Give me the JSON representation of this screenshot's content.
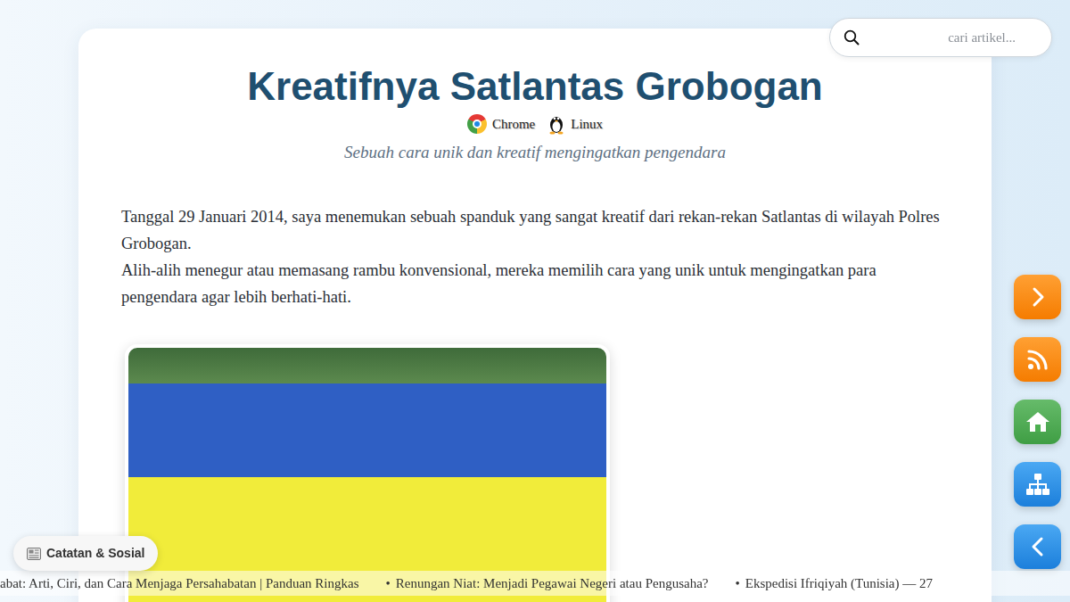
{
  "search": {
    "placeholder": "cari artikel..."
  },
  "article": {
    "title": "Kreatifnya Satlantas Grobogan",
    "platforms": [
      {
        "label": "Chrome",
        "kind": "chrome"
      },
      {
        "label": "Linux",
        "kind": "linux"
      }
    ],
    "subtitle": "Sebuah cara unik dan kreatif mengingatkan pengendara",
    "paragraphs": [
      "Tanggal 29 Januari 2014, saya menemukan sebuah spanduk yang sangat kreatif dari rekan-rekan Satlantas di wilayah Polres Grobogan.",
      "Alih-alih menegur atau memasang rambu konvensional, mereka memilih cara yang unik untuk mengingatkan para pengendara agar lebih berhati-hati."
    ]
  },
  "category_badge": {
    "label": "Catatan & Sosial"
  },
  "ticker": {
    "bullet": "•",
    "items": [
      {
        "text": "abat: Arti, Ciri, dan Cara Menjaga Persahabatan | Panduan Ringkas",
        "has_bullet": false
      },
      {
        "text": "Renungan Niat: Menjadi Pegawai Negeri atau Pengusaha?",
        "has_bullet": true
      },
      {
        "text": "Ekspedisi Ifriqiyah (Tunisia) — 27",
        "has_bullet": true
      }
    ]
  }
}
